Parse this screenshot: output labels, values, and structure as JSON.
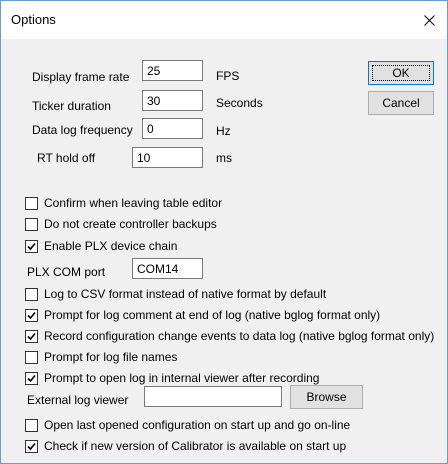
{
  "window": {
    "title": "Options"
  },
  "fields": {
    "display_frame_rate": {
      "label": "Display frame rate",
      "value": "25",
      "unit": "FPS"
    },
    "ticker_duration": {
      "label": "Ticker duration",
      "value": "30",
      "unit": "Seconds"
    },
    "data_log_frequency": {
      "label": "Data log frequency",
      "value": "0",
      "unit": "Hz"
    },
    "rt_hold_off": {
      "label": "RT hold off",
      "value": "10",
      "unit": "ms"
    }
  },
  "buttons": {
    "ok": "OK",
    "cancel": "Cancel",
    "browse": "Browse"
  },
  "checkboxes": [
    {
      "label": "Confirm when leaving table editor",
      "checked": false
    },
    {
      "label": "Do not create controller backups",
      "checked": false
    },
    {
      "label": "Enable PLX device chain",
      "checked": true
    },
    {
      "label": "Log to CSV format instead of native format by default",
      "checked": false
    },
    {
      "label": "Prompt for log comment at end of log (native bglog format only)",
      "checked": true
    },
    {
      "label": "Record configuration change events to data log (native bglog format only)",
      "checked": true
    },
    {
      "label": "Prompt for log file names",
      "checked": false
    },
    {
      "label": "Prompt to open log in internal viewer after recording",
      "checked": true
    },
    {
      "label": "Open last opened configuration on start up and go on-line",
      "checked": false
    },
    {
      "label": "Check if new version of Calibrator is available on start up",
      "checked": true
    }
  ],
  "plx_com_port": {
    "label": "PLX COM port",
    "value": "COM14"
  },
  "external_log_viewer": {
    "label": "External log viewer",
    "value": ""
  }
}
